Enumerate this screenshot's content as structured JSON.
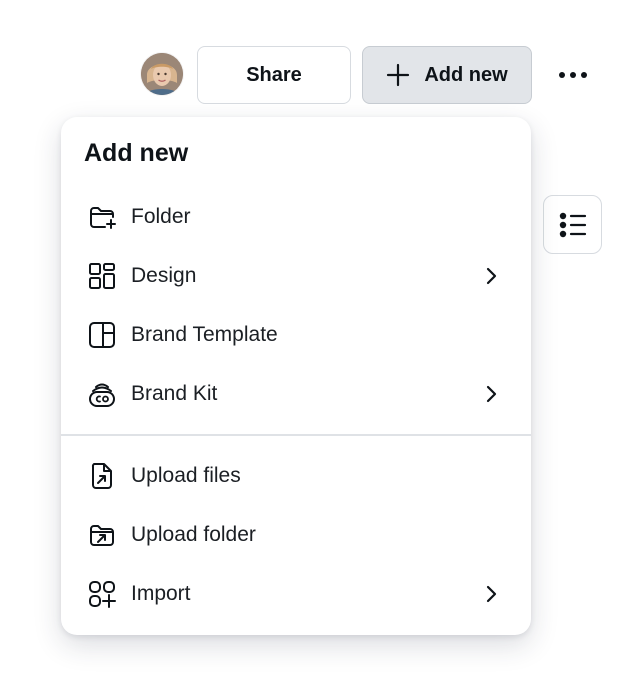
{
  "toolbar": {
    "avatar_icon": "user-avatar",
    "share_label": "Share",
    "add_new_label": "Add new",
    "add_icon": "plus-icon",
    "more_icon": "more-horizontal-icon",
    "list_view_icon": "list-view-icon"
  },
  "menu": {
    "title": "Add new",
    "items": [
      {
        "label": "Folder",
        "icon": "folder-plus-icon",
        "has_submenu": false
      },
      {
        "label": "Design",
        "icon": "design-grid-icon",
        "has_submenu": true
      },
      {
        "label": "Brand Template",
        "icon": "brand-template-icon",
        "has_submenu": false
      },
      {
        "label": "Brand Kit",
        "icon": "brand-kit-icon",
        "has_submenu": true
      },
      {
        "label": "Upload files",
        "icon": "upload-file-icon",
        "has_submenu": false
      },
      {
        "label": "Upload folder",
        "icon": "upload-folder-icon",
        "has_submenu": false
      },
      {
        "label": "Import",
        "icon": "import-icon",
        "has_submenu": true
      }
    ]
  },
  "colors": {
    "text": "#0e1318",
    "button_border": "#d7dbe0",
    "add_button_bg": "#e2e5e9",
    "divider": "#dfe2e6"
  }
}
